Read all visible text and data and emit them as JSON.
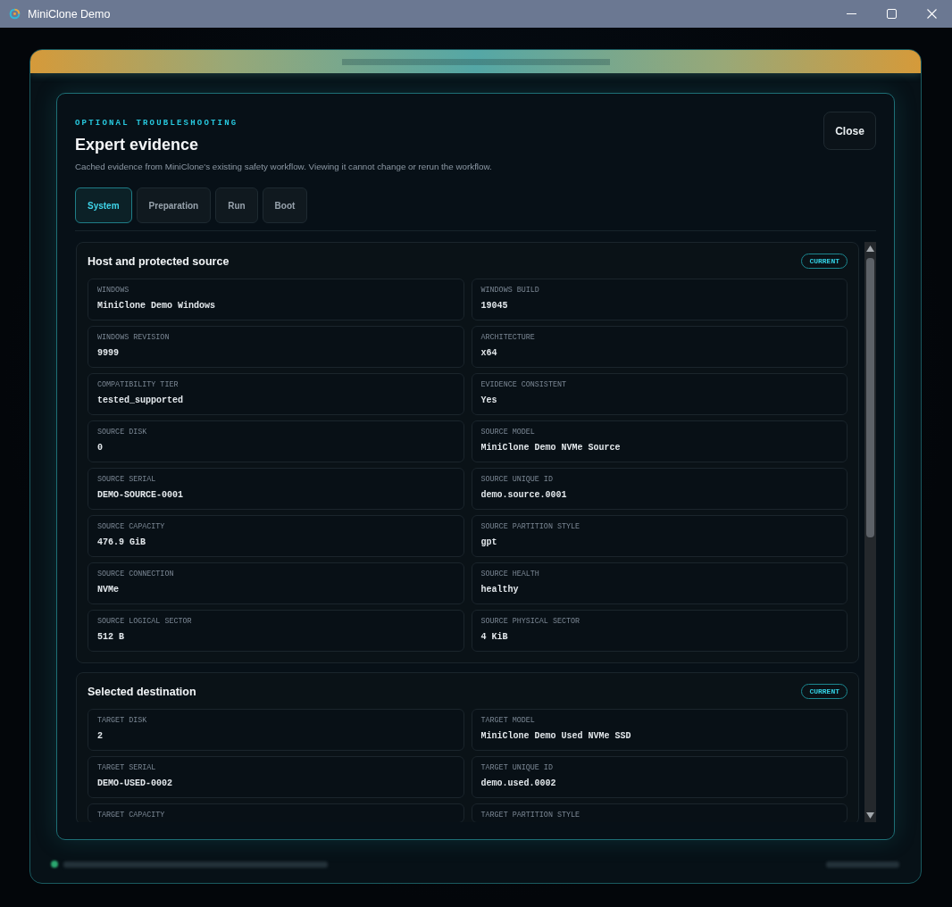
{
  "window": {
    "title": "MiniClone Demo"
  },
  "dialog": {
    "eyebrow": "OPTIONAL TROUBLESHOOTING",
    "title": "Expert evidence",
    "description": "Cached evidence from MiniClone's existing safety workflow. Viewing it cannot change or rerun the workflow.",
    "close_button": "Close",
    "tabs": [
      {
        "label": "System",
        "selected": true
      },
      {
        "label": "Preparation",
        "selected": false
      },
      {
        "label": "Run",
        "selected": false
      },
      {
        "label": "Boot",
        "selected": false
      }
    ],
    "sections": [
      {
        "title": "Host and protected source",
        "badge": "CURRENT",
        "fields": [
          {
            "label": "WINDOWS",
            "value": "MiniClone Demo Windows"
          },
          {
            "label": "WINDOWS BUILD",
            "value": "19045"
          },
          {
            "label": "WINDOWS REVISION",
            "value": "9999"
          },
          {
            "label": "ARCHITECTURE",
            "value": "x64"
          },
          {
            "label": "COMPATIBILITY TIER",
            "value": "tested_supported"
          },
          {
            "label": "EVIDENCE CONSISTENT",
            "value": "Yes"
          },
          {
            "label": "SOURCE DISK",
            "value": "0"
          },
          {
            "label": "SOURCE MODEL",
            "value": "MiniClone Demo NVMe Source"
          },
          {
            "label": "SOURCE SERIAL",
            "value": "DEMO-SOURCE-0001"
          },
          {
            "label": "SOURCE UNIQUE ID",
            "value": "demo.source.0001"
          },
          {
            "label": "SOURCE CAPACITY",
            "value": "476.9 GiB"
          },
          {
            "label": "SOURCE PARTITION STYLE",
            "value": "gpt"
          },
          {
            "label": "SOURCE CONNECTION",
            "value": "NVMe"
          },
          {
            "label": "SOURCE HEALTH",
            "value": "healthy"
          },
          {
            "label": "SOURCE LOGICAL SECTOR",
            "value": "512 B"
          },
          {
            "label": "SOURCE PHYSICAL SECTOR",
            "value": "4 KiB"
          }
        ]
      },
      {
        "title": "Selected destination",
        "badge": "CURRENT",
        "fields": [
          {
            "label": "TARGET DISK",
            "value": "2"
          },
          {
            "label": "TARGET MODEL",
            "value": "MiniClone Demo Used NVMe SSD"
          },
          {
            "label": "TARGET SERIAL",
            "value": "DEMO-USED-0002"
          },
          {
            "label": "TARGET UNIQUE ID",
            "value": "demo.used.0002"
          },
          {
            "label": "TARGET CAPACITY"
          },
          {
            "label": "TARGET PARTITION STYLE"
          }
        ]
      }
    ]
  }
}
